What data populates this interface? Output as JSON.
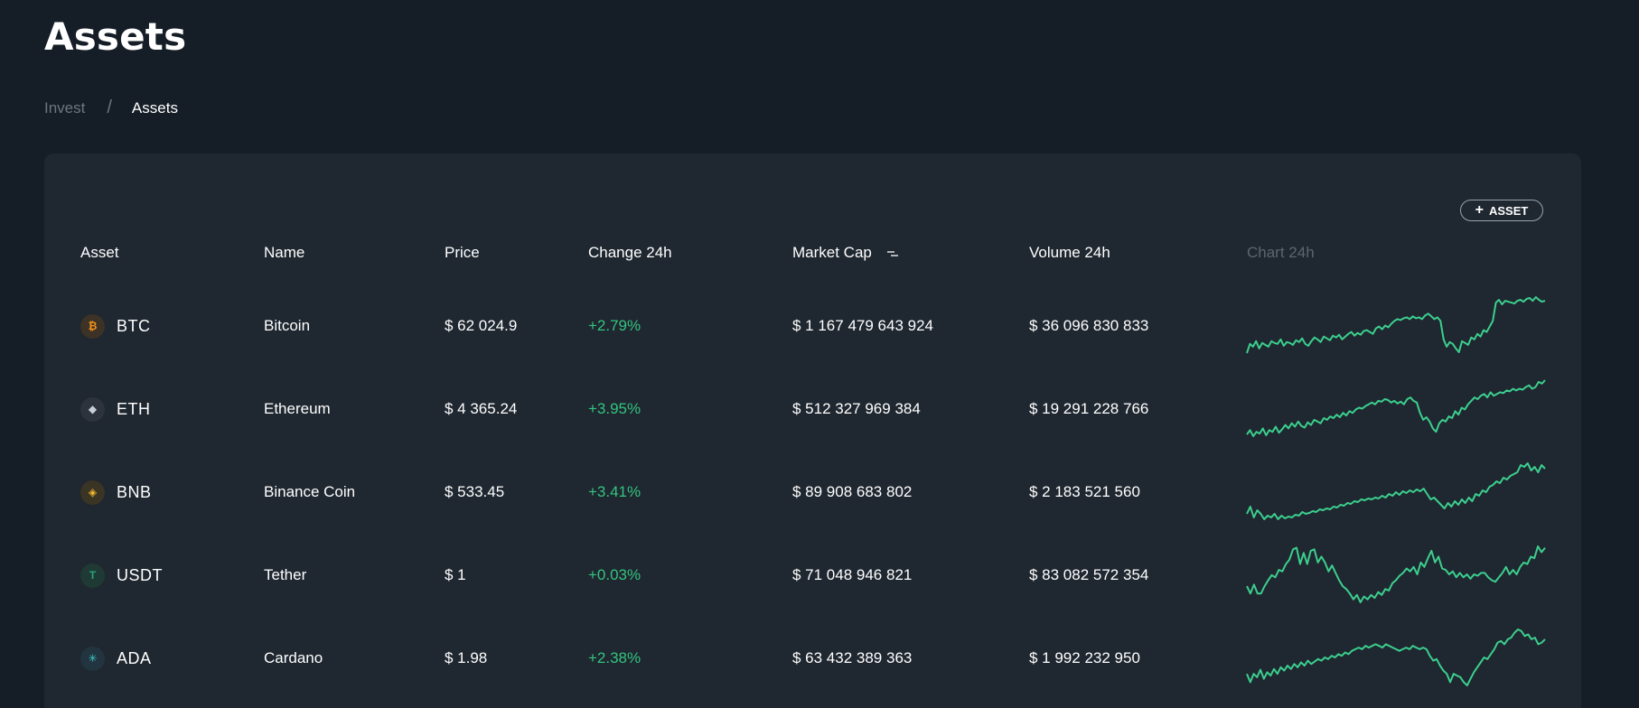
{
  "page": {
    "title": "Assets"
  },
  "breadcrumb": {
    "parent": "Invest",
    "separator": "/",
    "current": "Assets"
  },
  "toolbar": {
    "add_asset_plus": "+",
    "add_asset_label": "ASSET"
  },
  "table": {
    "headers": {
      "asset": "Asset",
      "name": "Name",
      "price": "Price",
      "change": "Change 24h",
      "market_cap": "Market Cap",
      "volume": "Volume 24h",
      "chart": "Chart 24h"
    },
    "sorted_column": "market_cap",
    "rows": [
      {
        "symbol": "BTC",
        "name": "Bitcoin",
        "price": "$ 62 024.9",
        "change": "+2.79%",
        "market_cap": "$ 1 167 479 643 924",
        "volume": "$ 36 096 830 833",
        "icon": "bitcoin-icon",
        "icon_glyph": "₿",
        "icon_color": "#f7931a",
        "icon_bg": "#3d3226",
        "sparkline": [
          35,
          45,
          42,
          48,
          40,
          46,
          44,
          42,
          48,
          46,
          45,
          50,
          43,
          47,
          46,
          44,
          49,
          47,
          51,
          45,
          43,
          48,
          52,
          50,
          47,
          53,
          51,
          49,
          54,
          52,
          55,
          50,
          53,
          56,
          58,
          54,
          57,
          55,
          59,
          60,
          58,
          56,
          62,
          64,
          61,
          65,
          63,
          67,
          70,
          72,
          71,
          73,
          74,
          72,
          75,
          73,
          74,
          72,
          76,
          78,
          75,
          72,
          74,
          70,
          50,
          42,
          47,
          45,
          40,
          36,
          48,
          46,
          44,
          52,
          50,
          56,
          53,
          60,
          58,
          64,
          70,
          90,
          93,
          88,
          92,
          91,
          90,
          89,
          92,
          93,
          91,
          94,
          95,
          92,
          96,
          93,
          91,
          92
        ]
      },
      {
        "symbol": "ETH",
        "name": "Ethereum",
        "price": "$ 4 365.24",
        "change": "+3.95%",
        "market_cap": "$ 512 327 969 384",
        "volume": "$ 19 291 228 766",
        "icon": "ethereum-icon",
        "icon_glyph": "◆",
        "icon_color": "#c9ced6",
        "icon_bg": "#2c333c",
        "sparkline": [
          35,
          40,
          33,
          38,
          36,
          42,
          34,
          40,
          38,
          44,
          37,
          41,
          46,
          42,
          48,
          44,
          50,
          45,
          43,
          49,
          46,
          52,
          50,
          48,
          54,
          52,
          56,
          54,
          58,
          55,
          60,
          57,
          62,
          60,
          64,
          66,
          65,
          68,
          70,
          72,
          70,
          74,
          73,
          76,
          75,
          72,
          74,
          71,
          73,
          70,
          76,
          78,
          74,
          72,
          60,
          52,
          55,
          50,
          42,
          38,
          48,
          52,
          50,
          56,
          54,
          62,
          58,
          66,
          64,
          70,
          74,
          78,
          76,
          80,
          82,
          78,
          84,
          80,
          82,
          84,
          83,
          86,
          85,
          88,
          86,
          88,
          87,
          90,
          92,
          88,
          90,
          96,
          94,
          98
        ]
      },
      {
        "symbol": "BNB",
        "name": "Binance Coin",
        "price": "$ 533.45",
        "change": "+3.41%",
        "market_cap": "$ 89 908 683 802",
        "volume": "$ 2 183 521 560",
        "icon": "binance-icon",
        "icon_glyph": "◈",
        "icon_color": "#f3ba2f",
        "icon_bg": "#3a3424",
        "sparkline": [
          40,
          48,
          36,
          44,
          40,
          34,
          38,
          36,
          40,
          34,
          38,
          35,
          37,
          36,
          39,
          38,
          42,
          40,
          41,
          43,
          42,
          45,
          44,
          46,
          45,
          48,
          47,
          50,
          49,
          52,
          51,
          54,
          53,
          56,
          55,
          57,
          56,
          58,
          57,
          60,
          58,
          62,
          60,
          64,
          61,
          65,
          63,
          66,
          64,
          67,
          65,
          68,
          62,
          56,
          58,
          54,
          50,
          46,
          52,
          48,
          54,
          50,
          56,
          52,
          58,
          54,
          62,
          60,
          66,
          64,
          70,
          72,
          76,
          74,
          80,
          78,
          82,
          84,
          86,
          94,
          92,
          96,
          88,
          92,
          86,
          94,
          90
        ]
      },
      {
        "symbol": "USDT",
        "name": "Tether",
        "price": "$ 1",
        "change": "+0.03%",
        "market_cap": "$ 71 048 946 821",
        "volume": "$ 83 082 572 354",
        "icon": "tether-icon",
        "icon_glyph": "T",
        "icon_color": "#26a17b",
        "icon_bg": "#1f3a34",
        "sparkline": [
          40,
          30,
          42,
          30,
          30,
          40,
          48,
          55,
          52,
          62,
          60,
          70,
          76,
          90,
          92,
          70,
          85,
          70,
          88,
          90,
          72,
          80,
          72,
          60,
          68,
          58,
          48,
          40,
          36,
          30,
          22,
          28,
          18,
          26,
          22,
          28,
          24,
          32,
          28,
          36,
          34,
          44,
          48,
          54,
          58,
          64,
          60,
          66,
          56,
          72,
          66,
          78,
          88,
          72,
          80,
          64,
          62,
          56,
          60,
          52,
          58,
          52,
          56,
          50,
          56,
          54,
          58,
          58,
          52,
          48,
          46,
          52,
          58,
          66,
          56,
          62,
          56,
          66,
          72,
          70,
          80,
          78,
          94,
          86,
          92
        ]
      },
      {
        "symbol": "ADA",
        "name": "Cardano",
        "price": "$ 1.98",
        "change": "+2.38%",
        "market_cap": "$ 63 432 389 363",
        "volume": "$ 1 992 232 950",
        "icon": "cardano-icon",
        "icon_glyph": "✳",
        "icon_color": "#3cc8c8",
        "icon_bg": "#22343f",
        "sparkline": [
          40,
          30,
          40,
          36,
          45,
          34,
          42,
          38,
          46,
          40,
          48,
          44,
          50,
          46,
          52,
          48,
          54,
          50,
          56,
          52,
          55,
          58,
          56,
          60,
          58,
          62,
          60,
          64,
          62,
          66,
          64,
          68,
          70,
          72,
          70,
          74,
          72,
          74,
          76,
          74,
          72,
          76,
          74,
          72,
          70,
          68,
          70,
          72,
          70,
          74,
          72,
          70,
          72,
          70,
          62,
          56,
          58,
          50,
          44,
          40,
          30,
          40,
          38,
          36,
          30,
          26,
          34,
          42,
          48,
          54,
          60,
          58,
          64,
          70,
          78,
          80,
          76,
          82,
          84,
          90,
          94,
          92,
          86,
          88,
          82,
          84,
          76,
          78,
          82
        ]
      }
    ]
  }
}
